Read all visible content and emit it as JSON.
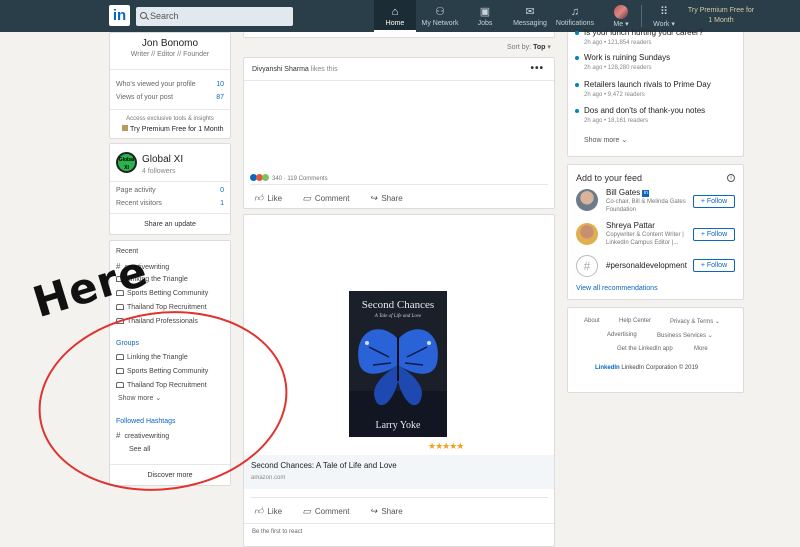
{
  "nav": {
    "logo": "in",
    "search_placeholder": "Search",
    "items": [
      {
        "label": "Home",
        "icon": "home-icon"
      },
      {
        "label": "My Network",
        "icon": "network-icon"
      },
      {
        "label": "Jobs",
        "icon": "briefcase-icon"
      },
      {
        "label": "Messaging",
        "icon": "message-icon"
      },
      {
        "label": "Notifications",
        "icon": "bell-icon"
      },
      {
        "label": "Me",
        "icon": "avatar-icon"
      },
      {
        "label": "Work",
        "icon": "grid-icon"
      }
    ],
    "premium": "Try Premium Free for 1 Month"
  },
  "profile": {
    "name": "Jon Bonomo",
    "title": "Writer // Editor // Founder",
    "stats": [
      {
        "label": "Who's viewed your profile",
        "value": "10"
      },
      {
        "label": "Views of your post",
        "value": "87"
      }
    ],
    "access": "Access exclusive tools & insights",
    "premium": "Try Premium Free for 1 Month"
  },
  "page": {
    "logo_text": "Global XI",
    "name": "Global XI",
    "followers": "4 followers",
    "stats": [
      {
        "label": "Page activity",
        "value": "0"
      },
      {
        "label": "Recent visitors",
        "value": "1"
      }
    ],
    "share": "Share an update"
  },
  "sidebar": {
    "recent_head": "Recent",
    "recent": [
      "creativewriting",
      "Linking the Triangle",
      "Sports Betting Community",
      "Thailand Top Recruitment",
      "Thailand Professionals"
    ],
    "groups_head": "Groups",
    "groups": [
      "Linking the Triangle",
      "Sports Betting Community",
      "Thailand Top Recruitment"
    ],
    "show_more": "Show more",
    "hashtags_head": "Followed Hashtags",
    "hashtag": "creativewriting",
    "see_all": "See all",
    "discover": "Discover more"
  },
  "feed": {
    "sort_label": "Sort by:",
    "sort_value": "Top",
    "post1": {
      "actor": "Divyanshi Sharma",
      "action": "likes this",
      "reactions": "340 · 119 Comments",
      "actions": [
        "Like",
        "Comment",
        "Share"
      ]
    },
    "post2": {
      "book_title": "Second Chances",
      "book_subtitle": "A Tale of Life and Love",
      "book_author": "Larry Yoke",
      "stars": "★★★★★",
      "link_title": "Second Chances: A Tale of Life and Love",
      "link_domain": "amazon.com",
      "actions": [
        "Like",
        "Comment",
        "Share"
      ],
      "first_react": "Be the first to react"
    }
  },
  "news": [
    {
      "title": "Is your lunch hurting your career?",
      "meta": "2h ago • 121,854 readers"
    },
    {
      "title": "Work is ruining Sundays",
      "meta": "2h ago • 128,280 readers"
    },
    {
      "title": "Retailers launch rivals to Prime Day",
      "meta": "2h ago • 9,472 readers"
    },
    {
      "title": "Dos and don'ts of thank-you notes",
      "meta": "2h ago • 18,161 readers"
    }
  ],
  "news_show_more": "Show more",
  "add_feed": {
    "title": "Add to your feed",
    "recs": [
      {
        "name": "Bill Gates",
        "desc": "Co-chair, Bill & Melinda Gates Foundation",
        "follow": "+ Follow"
      },
      {
        "name": "Shreya Pattar",
        "desc": "Copywriter & Content Writer | LinkedIn Campus Editor |...",
        "follow": "+ Follow"
      },
      {
        "name": "#personaldevelopment",
        "desc": "",
        "follow": "+ Follow"
      }
    ],
    "view_all": "View all recommendations"
  },
  "footer": {
    "links": [
      "About",
      "Help Center",
      "Privacy & Terms",
      "Advertising",
      "Business Services",
      "Get the LinkedIn app",
      "More"
    ],
    "brand": "LinkedIn",
    "copyright": "LinkedIn Corporation © 2019"
  },
  "annotation": {
    "text": "Here",
    "color": "#e0322f"
  }
}
